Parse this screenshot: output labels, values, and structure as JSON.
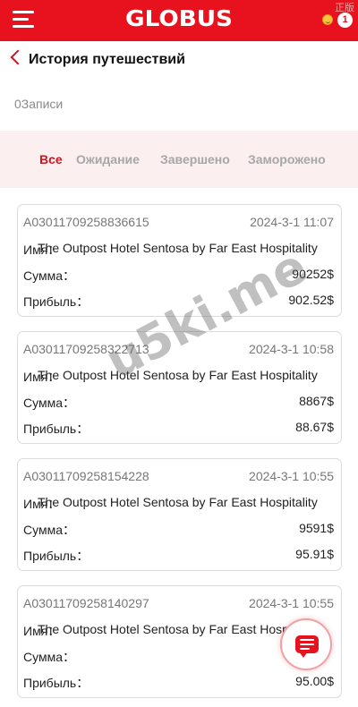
{
  "app": {
    "logo": "GLOBUS",
    "corner_mark": "正版",
    "notification_count": "1",
    "brand_color": "#e8121e"
  },
  "page": {
    "title": "История путешествий",
    "records_count": "0Записи"
  },
  "tabs": [
    {
      "label": "Все",
      "active": true
    },
    {
      "label": "Ожидание",
      "active": false
    },
    {
      "label": "Завершено",
      "active": false
    },
    {
      "label": "Заморожено",
      "active": false
    }
  ],
  "labels": {
    "name": "Имя：",
    "amount": "Сумма：",
    "profit": "Прибыль："
  },
  "orders": [
    {
      "id": "A03011709258836615",
      "time": "2024-3-1 11:07",
      "hotel": "The Outpost Hotel Sentosa by Far East Hospitality",
      "amount": "90252$",
      "profit": "902.52$"
    },
    {
      "id": "A03011709258322713",
      "time": "2024-3-1 10:58",
      "hotel": "The Outpost Hotel Sentosa by Far East Hospitality",
      "amount": "8867$",
      "profit": "88.67$"
    },
    {
      "id": "A03011709258154228",
      "time": "2024-3-1 10:55",
      "hotel": "The Outpost Hotel Sentosa by Far East Hospitality",
      "amount": "9591$",
      "profit": "95.91$"
    },
    {
      "id": "A03011709258140297",
      "time": "2024-3-1 10:55",
      "hotel": "The Outpost Hotel Sentosa by Far East Hospitality",
      "amount": "",
      "profit": "95.00$"
    }
  ],
  "watermark": "u5ki.me"
}
